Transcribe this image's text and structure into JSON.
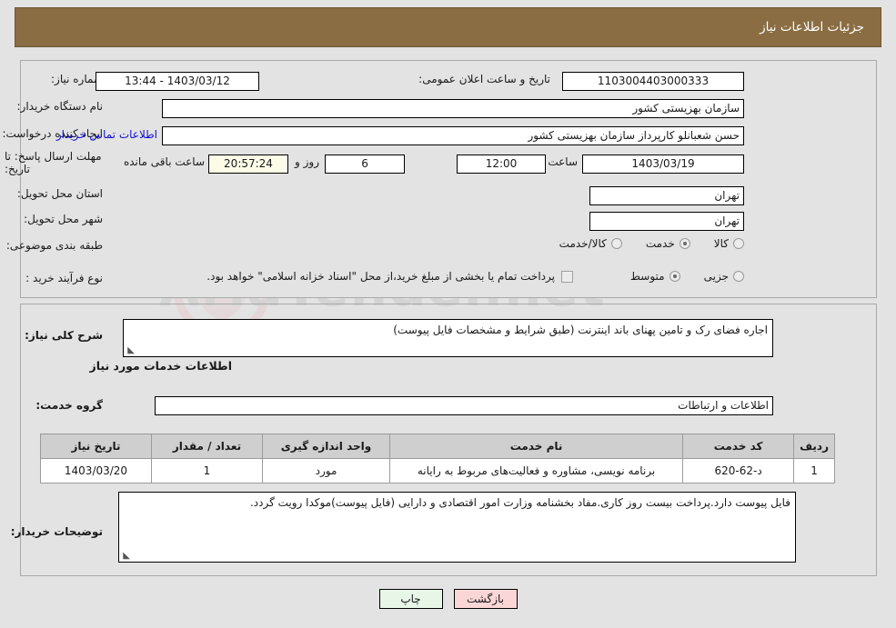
{
  "header": {
    "title": "جزئیات اطلاعات نیاز",
    "bg_color": "#8a6d43",
    "text_color": "#ffffff"
  },
  "form": {
    "need_number_label": "شماره نیاز:",
    "need_number_value": "1103004403000333",
    "announce_datetime_label": "تاریخ و ساعت اعلان عمومی:",
    "announce_datetime_value": "1403/03/12 - 13:44",
    "buyer_org_label": "نام دستگاه خریدار:",
    "buyer_org_value": "سازمان بهزیستی کشور",
    "requester_label": "ایجاد کننده درخواست:",
    "requester_value": "حسن  شعبانلو کارپرداز سازمان بهزیستی کشور",
    "contact_link": "اطلاعات تماس خریدار",
    "deadline_label": "مهلت ارسال پاسخ: تا تاریخ:",
    "deadline_date": "1403/03/19",
    "deadline_hour_label": "ساعت",
    "deadline_hour": "12:00",
    "days_remaining": "6",
    "days_word": "روز و",
    "time_remaining": "20:57:24",
    "remaining_suffix": "ساعت باقی مانده",
    "province_label": "استان محل تحویل:",
    "province_value": "تهران",
    "city_label": "شهر محل تحویل:",
    "city_value": "تهران",
    "category_label": "طبقه بندی موضوعی:",
    "category_options": [
      {
        "label": "کالا",
        "selected": false
      },
      {
        "label": "خدمت",
        "selected": true
      },
      {
        "label": "کالا/خدمت",
        "selected": false
      }
    ],
    "process_label": "نوع فرآیند خرید :",
    "process_options": [
      {
        "label": "جزیی",
        "selected": false
      },
      {
        "label": "متوسط",
        "selected": true
      }
    ],
    "treasury_checkbox_checked": false,
    "treasury_text": "پرداخت تمام یا بخشی از مبلغ خرید،از محل \"اسناد خزانه اسلامی\" خواهد بود."
  },
  "summary": {
    "label": "شرح کلی نیاز:",
    "value": "اجاره فضای رک و تامین پهنای باند اینترنت (طبق شرایط و مشخصات فایل پیوست)"
  },
  "services_section": {
    "heading": "اطلاعات خدمات مورد نیاز",
    "group_label": "گروه خدمت:",
    "group_value": "اطلاعات و ارتباطات"
  },
  "table": {
    "columns": [
      "ردیف",
      "کد خدمت",
      "نام خدمت",
      "واحد اندازه گیری",
      "تعداد / مقدار",
      "تاریخ نیاز"
    ],
    "rows": [
      {
        "index": "1",
        "code": "د-62-620",
        "name": "برنامه نویسی، مشاوره و فعالیت‌های مربوط به رایانه",
        "unit": "مورد",
        "quantity": "1",
        "date": "1403/03/20"
      }
    ]
  },
  "buyer_notes": {
    "label": "توضیحات خریدار:",
    "value": "فایل پیوست دارد.پرداخت بیست روز کاری.مفاد بخشنامه وزارت امور اقتصادی و دارایی (فایل پیوست)موکدا رویت گردد."
  },
  "buttons": {
    "print": "چاپ",
    "back": "بازگشت"
  },
  "watermark": {
    "text": "AriaTender.net"
  }
}
